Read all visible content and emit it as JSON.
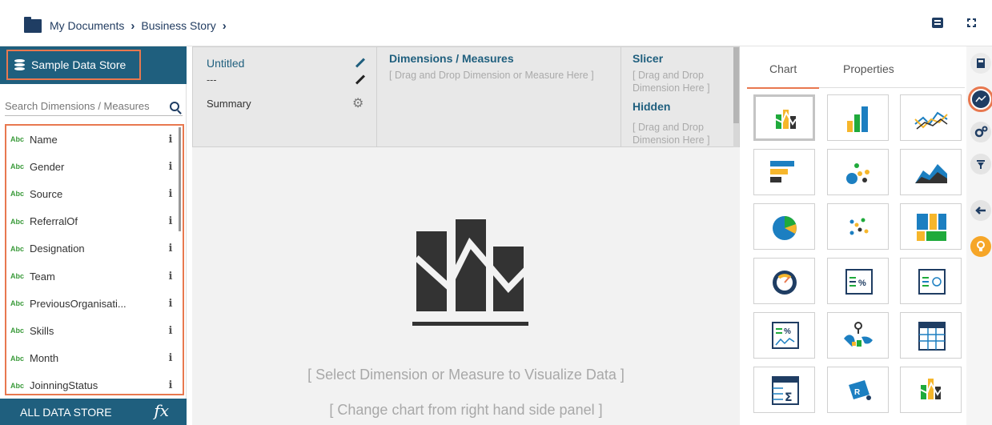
{
  "breadcrumb": {
    "items": [
      "My Documents",
      "Business Story"
    ]
  },
  "left_panel": {
    "data_store_label": "Sample Data Store",
    "search_placeholder": "Search Dimensions / Measures",
    "fields": [
      {
        "type": "Abc",
        "name": "Name"
      },
      {
        "type": "Abc",
        "name": "Gender"
      },
      {
        "type": "Abc",
        "name": "Source"
      },
      {
        "type": "Abc",
        "name": "ReferralOf"
      },
      {
        "type": "Abc",
        "name": "Designation"
      },
      {
        "type": "Abc",
        "name": "Team"
      },
      {
        "type": "Abc",
        "name": "PreviousOrganisati..."
      },
      {
        "type": "Abc",
        "name": "Skills"
      },
      {
        "type": "Abc",
        "name": "Month"
      },
      {
        "type": "Abc",
        "name": "JoinningStatus"
      }
    ],
    "info_glyph": "i",
    "all_data_store_label": "ALL DATA STORE",
    "fx_label": "fx"
  },
  "config": {
    "name": {
      "title": "Untitled",
      "subtitle": "---",
      "summary": "Summary"
    },
    "dims": {
      "title": "Dimensions / Measures",
      "placeholder": "[ Drag and Drop Dimension or Measure Here ]"
    },
    "slicer": {
      "title": "Slicer",
      "placeholder": "[ Drag and Drop Dimension Here ]"
    },
    "hidden": {
      "title": "Hidden",
      "placeholder": "[ Drag and Drop Dimension Here ]"
    }
  },
  "canvas": {
    "message_1": "[ Select Dimension or Measure to Visualize Data ]",
    "message_2": "[ Change chart from right hand side panel ]"
  },
  "right_panel": {
    "tabs": [
      {
        "label": "Chart",
        "active": true
      },
      {
        "label": "Properties",
        "active": false
      }
    ],
    "chart_types": [
      "default-chart",
      "column-chart",
      "line-chart",
      "bar-chart",
      "bubble-chart",
      "area-chart",
      "pie-chart",
      "scatter-chart",
      "treemap-chart",
      "gauge-chart",
      "kpi-percent",
      "kpi-trend",
      "progress-kpi",
      "map-chart",
      "table-chart",
      "pivot-table",
      "r-chart",
      "chart-3"
    ]
  },
  "colors": {
    "primary": "#1f5f7e",
    "accent": "#e8784f",
    "yellow": "#f6b62b",
    "green": "#1faa3b",
    "blue": "#1c7fc1",
    "dark": "#333333"
  }
}
